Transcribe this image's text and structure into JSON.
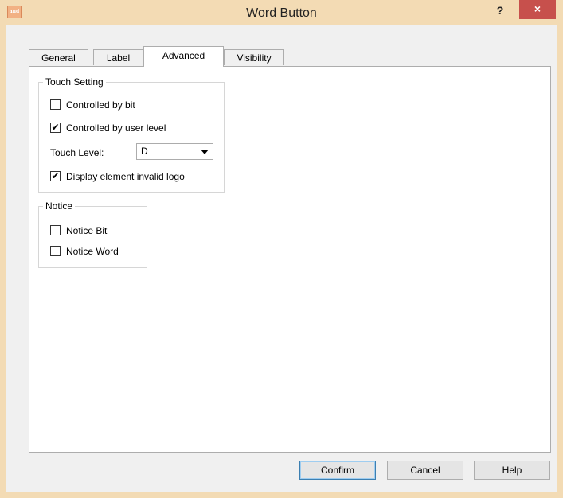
{
  "window": {
    "title": "Word Button",
    "app_icon_text": "and",
    "help_glyph": "?",
    "close_glyph": "×"
  },
  "tabs": [
    {
      "label": "General",
      "active": false
    },
    {
      "label": "Label",
      "active": false
    },
    {
      "label": "Advanced",
      "active": true
    },
    {
      "label": "Visibility",
      "active": false
    }
  ],
  "touch_setting": {
    "title": "Touch Setting",
    "controlled_by_bit": {
      "label": "Controlled by bit",
      "checked": false
    },
    "controlled_by_user_level": {
      "label": "Controlled by user level",
      "checked": true
    },
    "touch_level_label": "Touch Level:",
    "touch_level_value": "D",
    "display_invalid_logo": {
      "label": "Display element invalid logo",
      "checked": true
    }
  },
  "notice": {
    "title": "Notice",
    "notice_bit": {
      "label": "Notice Bit",
      "checked": false
    },
    "notice_word": {
      "label": "Notice Word",
      "checked": false
    }
  },
  "buttons": {
    "confirm": "Confirm",
    "cancel": "Cancel",
    "help": "Help"
  },
  "check_glyph": "✔",
  "colors": {
    "titlebar": "#f3dbb4",
    "close_button": "#c7504c",
    "default_button_border": "#3c7fb1"
  }
}
